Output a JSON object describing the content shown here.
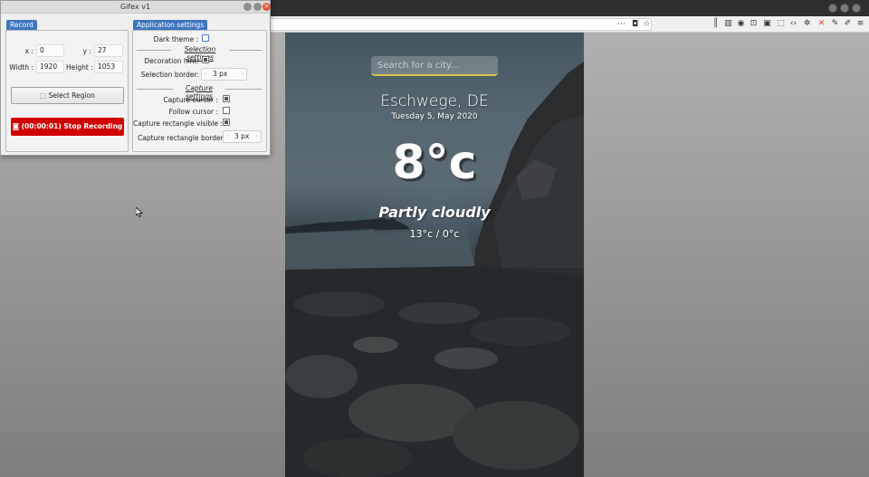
{
  "gifex": {
    "title": "Gifex v1",
    "record_tab": "Record",
    "settings_tab": "Application settings",
    "x_label": "x :",
    "x_value": "0",
    "y_label": "y :",
    "y_value": "27",
    "width_label": "Width :",
    "width_value": "1920",
    "height_label": "Height :",
    "height_value": "1053",
    "select_region": "Select Region",
    "stop_recording": "(00:00:01) Stop Recording",
    "dark_theme_label": "Dark theme :",
    "dark_theme": false,
    "selection_settings": "Selection settings",
    "decoration_hint_label": "Decoration hint:",
    "decoration_hint": true,
    "selection_border_label": "Selection border:",
    "selection_border_value": "3 px",
    "capture_settings": "Capture settings",
    "capture_cursor_label": "Capture cursor :",
    "capture_cursor": true,
    "follow_cursor_label": "Follow cursor :",
    "follow_cursor": false,
    "capture_rect_visible_label": "Capture rectangle visible :",
    "capture_rect_visible": true,
    "capture_rect_border_label": "Capture rectangle border :",
    "capture_rect_border_value": "3 px"
  },
  "weather": {
    "search_placeholder": "Search for a city...",
    "city": "Eschwege, DE",
    "date": "Tuesday 5, May 2020",
    "temperature": "8°c",
    "condition": "Partly cloudly",
    "range": "13°c / 0°c",
    "accent_color": "#d8c24a"
  },
  "browser": {
    "icons": [
      "library-icon",
      "sidebar-icon",
      "account-icon",
      "screenshot-icon",
      "extension-icon",
      "extension-icon",
      "devtools-icon",
      "settings-icon",
      "close-tools-icon",
      "eyedropper-icon",
      "pen-icon",
      "text-icon",
      "menu-icon"
    ]
  }
}
